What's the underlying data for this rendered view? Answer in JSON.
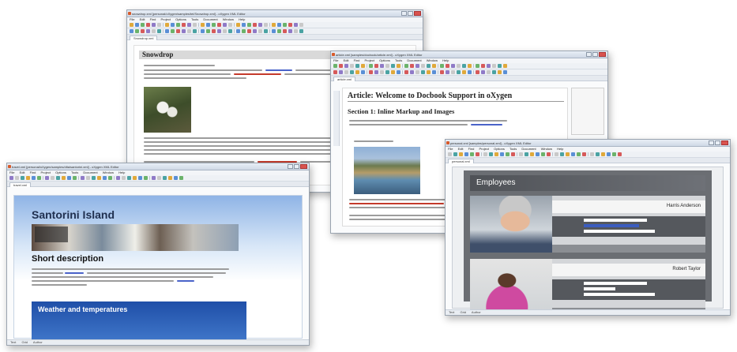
{
  "menu_items": [
    "File",
    "Edit",
    "Find",
    "Project",
    "Options",
    "Tools",
    "Document",
    "Window",
    "Help"
  ],
  "windows": {
    "snowdrop": {
      "title_text": "snowdrop.xml [personal/oXygen/samples/tei/Snowdrop.xml] - oXygen XML Editor",
      "tab_label": "Snowdrop.xml",
      "doc_title": "Snowdrop"
    },
    "santorini": {
      "title_text": "travel.xml [personal/oXygen/samples/dita/santorini.xml] - oXygen XML Editor",
      "tab_label": "travel.xml",
      "page_title": "Santorini Island",
      "section_heading": "Short description",
      "weather_heading": "Weather and temperatures"
    },
    "docbook": {
      "title_text": "article.xml [samples/docbook/article.xml] - oXygen XML Editor",
      "tab_label": "article.xml",
      "article_title": "Article: Welcome to Docbook Support in oXygen",
      "section_title": "Section 1: Inline Markup and Images"
    },
    "employees": {
      "title_text": "personal.xml [samples/personal.xml] - oXygen XML Editor",
      "tab_label": "personal.xml",
      "header": "Employees",
      "people": [
        {
          "name": "Harris Anderson"
        },
        {
          "name": "Robert Taylor"
        }
      ]
    }
  },
  "status_labels": [
    "Text",
    "Grid",
    "Author"
  ]
}
